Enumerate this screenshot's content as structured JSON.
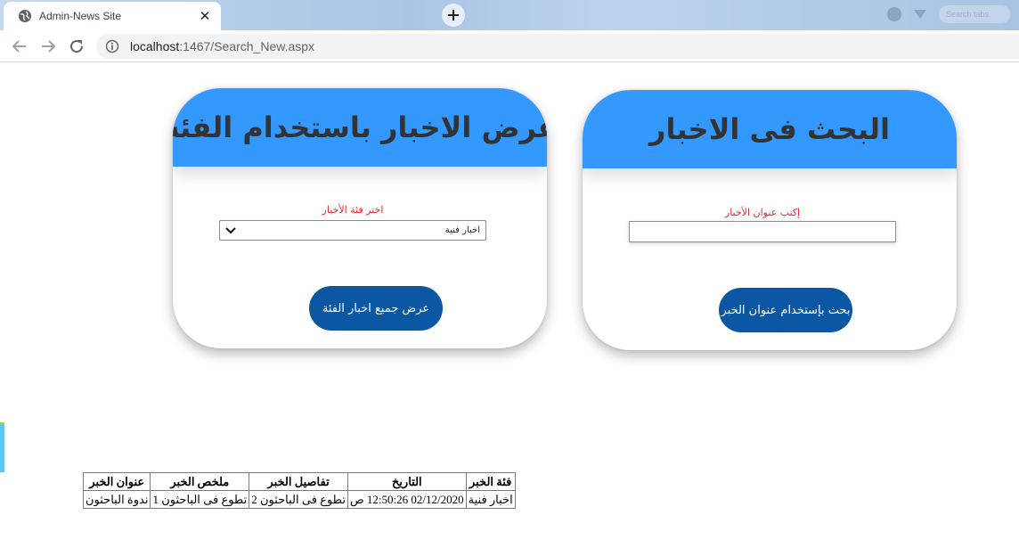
{
  "browser": {
    "tab_title": "Admin-News Site",
    "tab_close": "✕",
    "new_tab": "+",
    "url_host": "localhost",
    "url_path": ":1467/Search_New.aspx",
    "search_hint": "Search tabs"
  },
  "search_card": {
    "title": "البحث فى الاخبار",
    "label": "إكتب عنوان الأخبار",
    "input_value": "",
    "button": "بحث بإستخدام عنوان الخبر"
  },
  "category_card": {
    "title": "عرض الاخبار باستخدام الفئة",
    "label": "اختر فئة الأخبار",
    "select_value": "اخبار فنية",
    "button": "عرض جميع اخبار الفئة"
  },
  "table": {
    "headers": [
      "فئة الخبر",
      "التاريخ",
      "تفاصيل الخبر",
      "ملخص الخبر",
      "عنوان الخبر"
    ],
    "rows": [
      [
        "اخبار فنية",
        "02/12/2020 12:50:26 ص",
        "تطوع فى الباحثون 2",
        "تطوع فى الباحثون 1",
        "ندوة الباحثون"
      ]
    ]
  }
}
